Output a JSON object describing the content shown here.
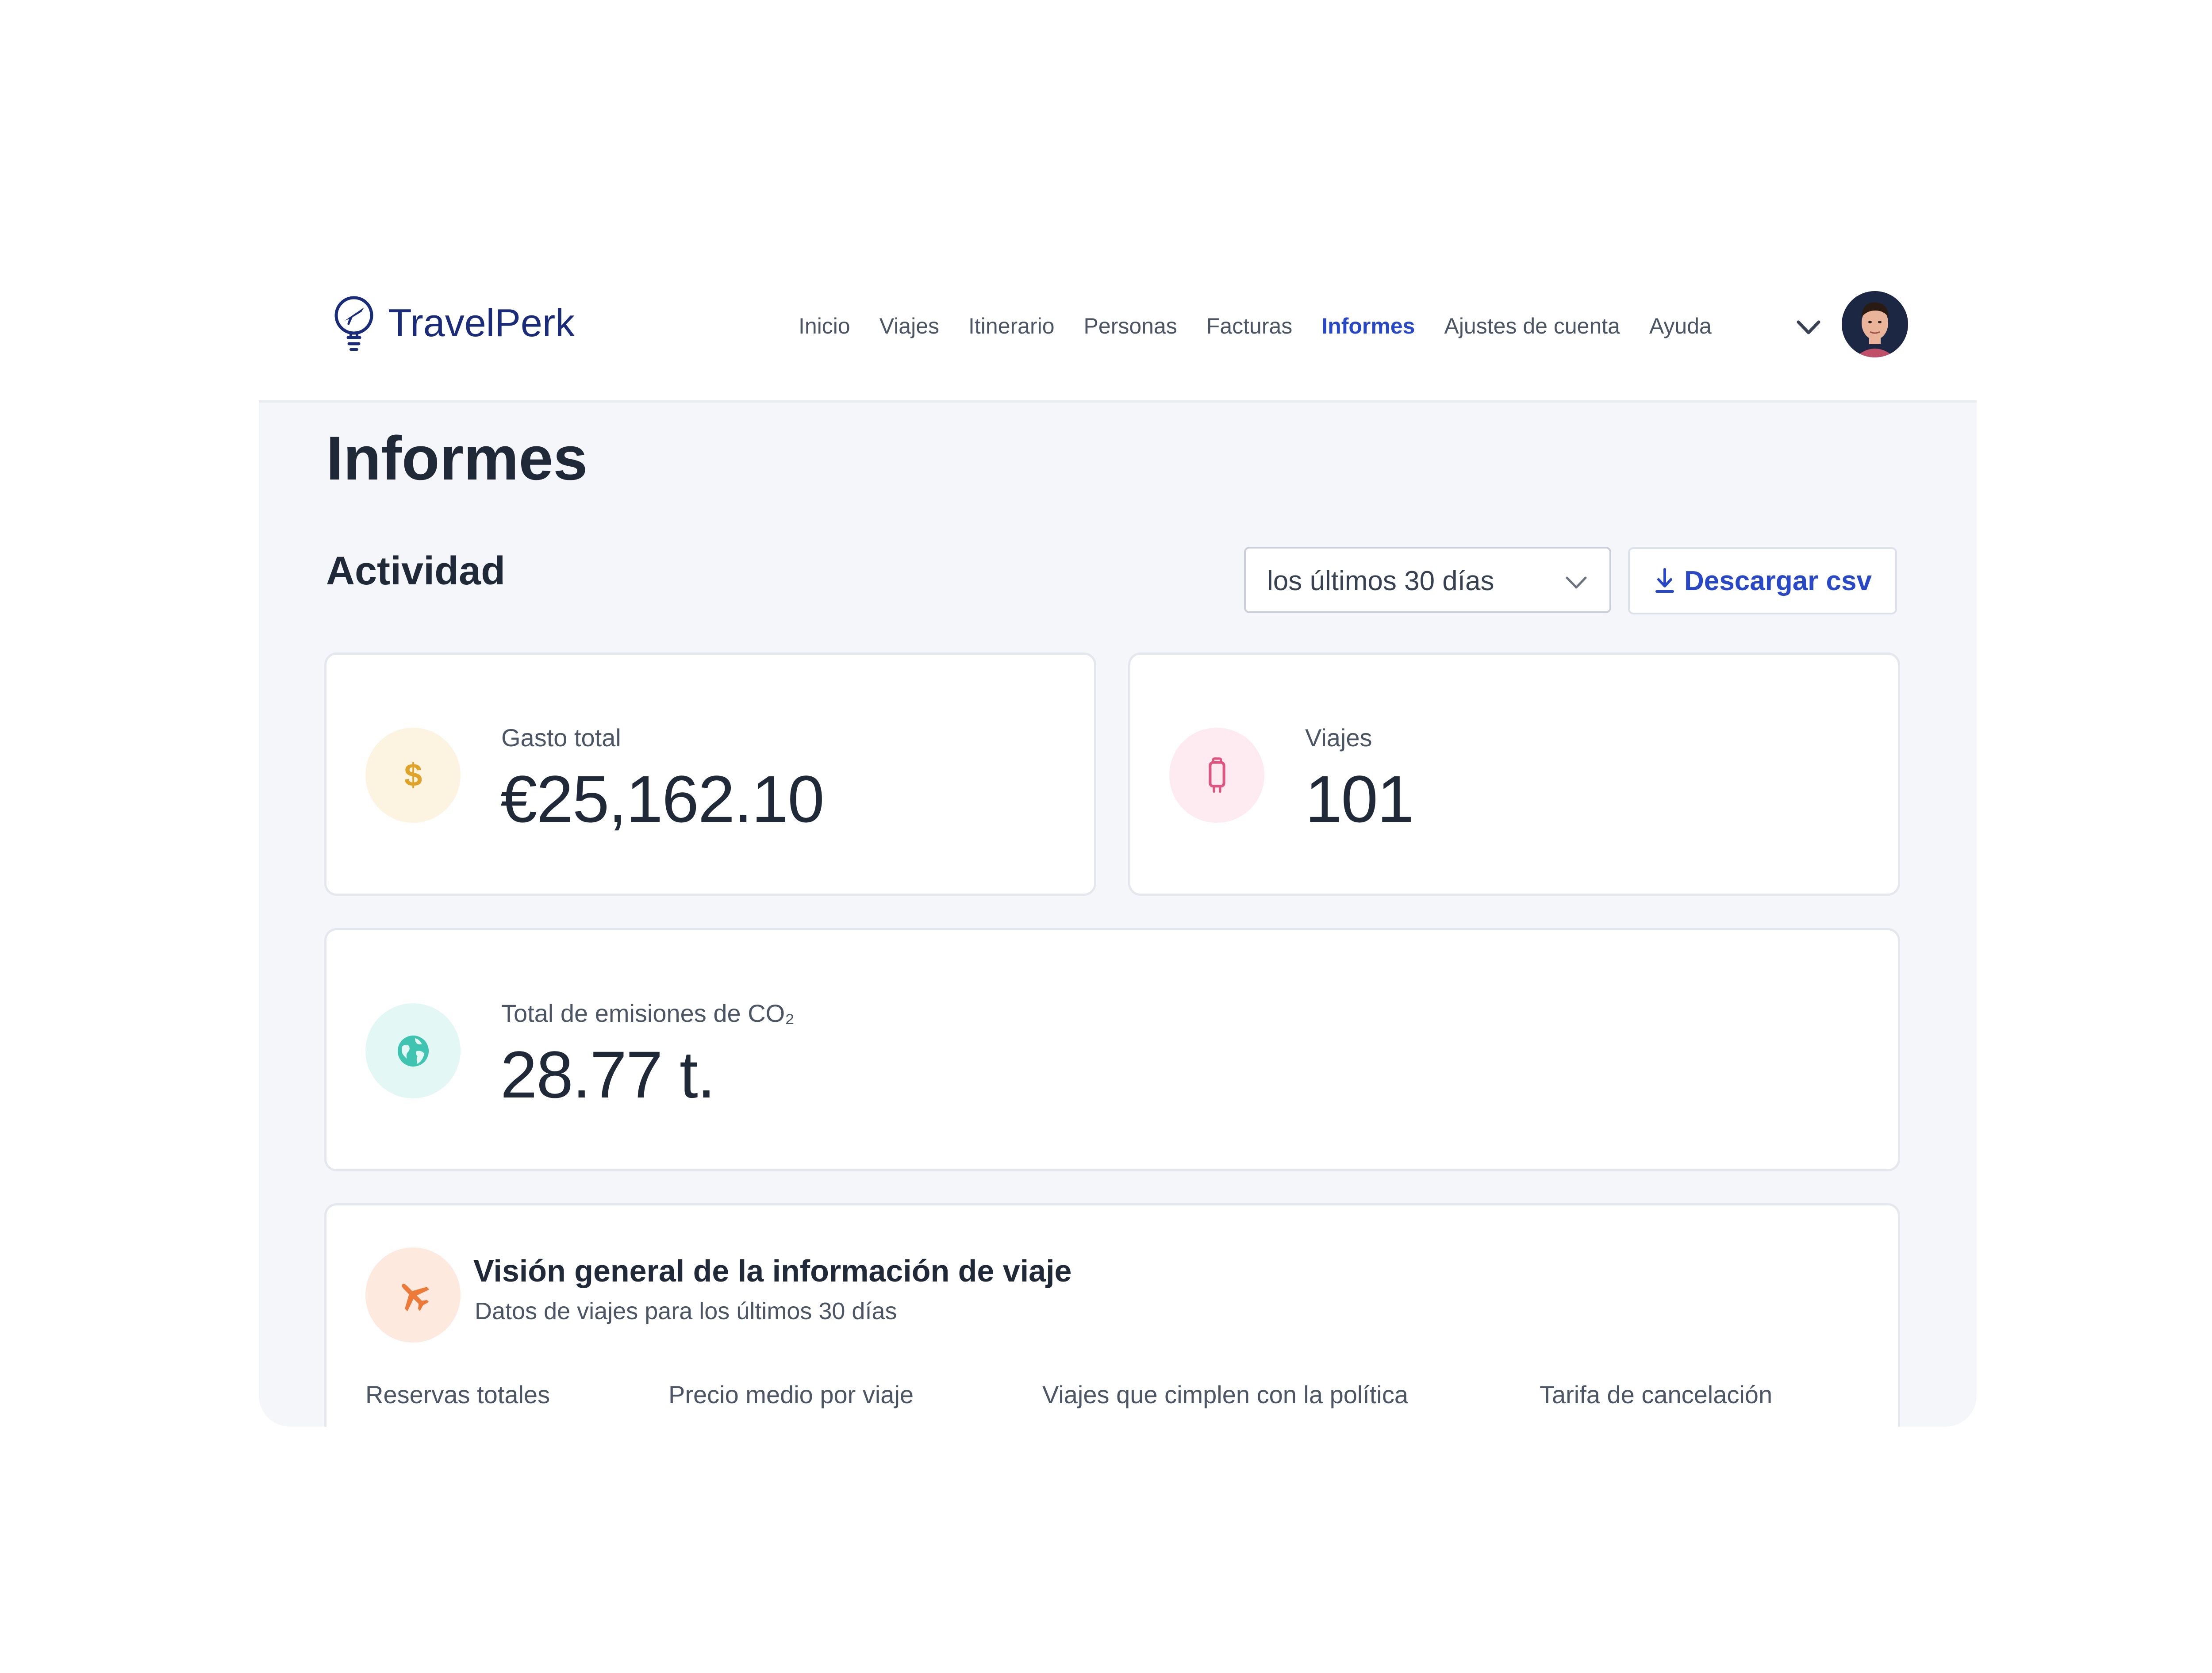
{
  "brand": {
    "name": "TravelPerk",
    "color": "#1a2b7a"
  },
  "nav": {
    "items": [
      {
        "label": "Inicio",
        "active": false
      },
      {
        "label": "Viajes",
        "active": false
      },
      {
        "label": "Itinerario",
        "active": false
      },
      {
        "label": "Personas",
        "active": false
      },
      {
        "label": "Facturas",
        "active": false
      },
      {
        "label": "Informes",
        "active": true
      },
      {
        "label": "Ajustes de cuenta",
        "active": false
      },
      {
        "label": "Ayuda",
        "active": false
      }
    ],
    "active_color": "#2848c8",
    "dropdown_icon": "chevron-down-icon",
    "avatar_icon": "avatar"
  },
  "page": {
    "title": "Informes"
  },
  "activity": {
    "title": "Actividad",
    "period_select": {
      "value": "los últimos 30 días",
      "icon": "chevron-down-icon"
    },
    "download_button": {
      "label": "Descargar csv",
      "icon": "download-icon"
    }
  },
  "stats": {
    "spend": {
      "label": "Gasto total",
      "value": "€25,162.10",
      "icon": "dollar-icon",
      "icon_color": "#e0a32a",
      "icon_bg": "#fdf3e1"
    },
    "trips": {
      "label": "Viajes",
      "value": "101",
      "icon": "luggage-icon",
      "icon_color": "#e0557f",
      "icon_bg": "#fdebf1"
    },
    "co2": {
      "label": "Total  de emisiones de CO₂",
      "value": "28.77 t.",
      "icon": "globe-icon",
      "icon_color": "#3ec4b0",
      "icon_bg": "#e3f8f5"
    }
  },
  "overview": {
    "title": "Visión general de la información de viaje",
    "subtitle": "Datos de viajes para los últimos 30 días",
    "icon": "airplane-icon",
    "icon_color": "#ee7a3a",
    "columns": [
      "Reservas totales",
      "Precio medio por viaje",
      "Viajes que cimplen con la política",
      "Tarifa de cancelación"
    ]
  }
}
